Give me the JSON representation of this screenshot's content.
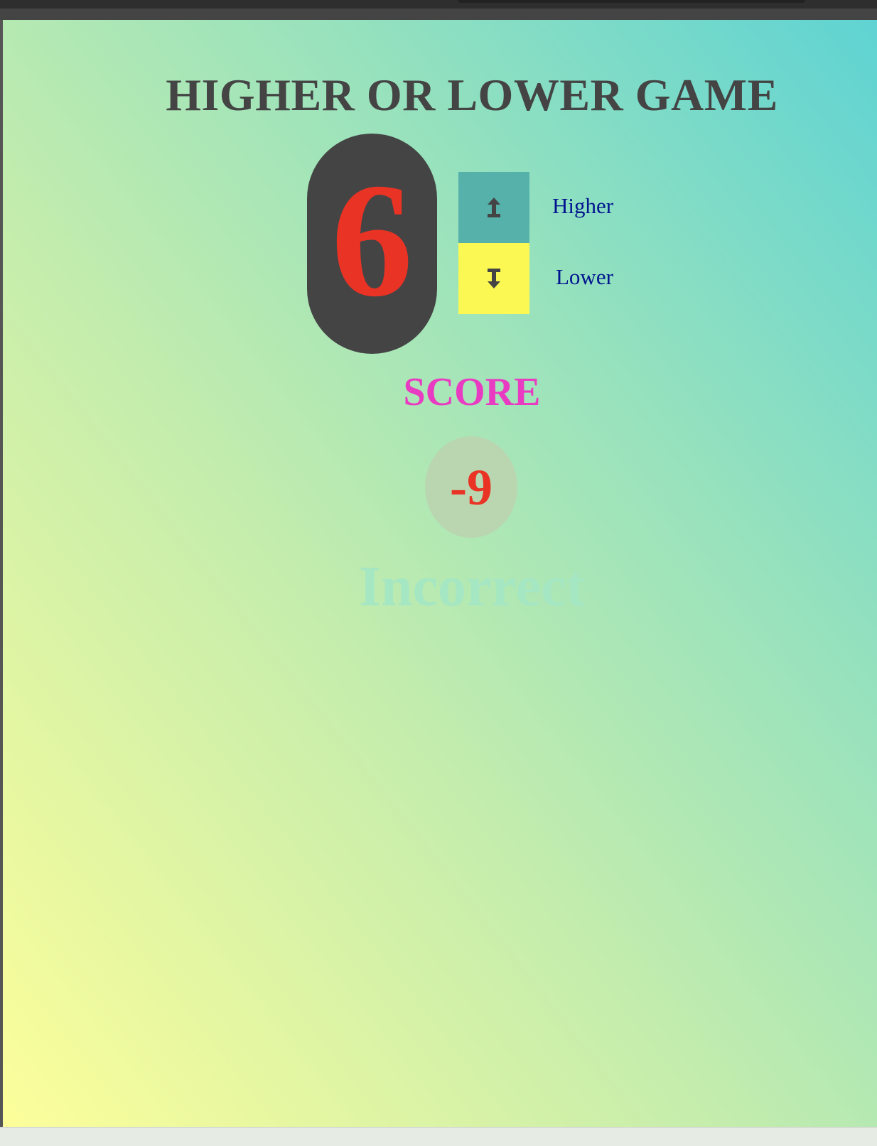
{
  "title": "HIGHER OR LOWER GAME",
  "current_number": "6",
  "buttons": {
    "higher": {
      "label": "Higher",
      "icon": "arrow-up-icon",
      "color": "#56b1ab"
    },
    "lower": {
      "label": "Lower",
      "icon": "arrow-down-icon",
      "color": "#fbf853"
    }
  },
  "score": {
    "heading": "SCORE",
    "value": "-9"
  },
  "result": "Incorrect",
  "colors": {
    "title": "#444444",
    "number": "#e93325",
    "score_heading": "#e93bc2",
    "button_label": "#00148e",
    "result": "#a5e6c3"
  }
}
